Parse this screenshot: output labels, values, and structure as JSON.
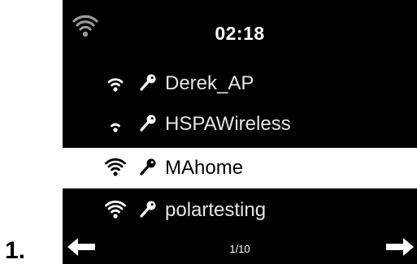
{
  "step_number": "1.",
  "status": {
    "wifi_icon": "wifi-signal-icon",
    "clock": "02:18"
  },
  "networks": [
    {
      "ssid": "Derek_AP",
      "secured": true,
      "signal_bars": 3,
      "selected": false
    },
    {
      "ssid": "HSPAWireless",
      "secured": true,
      "signal_bars": 2,
      "selected": false
    },
    {
      "ssid": "MAhome",
      "secured": true,
      "signal_bars": 4,
      "selected": true
    },
    {
      "ssid": "polartesting",
      "secured": true,
      "signal_bars": 4,
      "selected": false
    }
  ],
  "footer": {
    "page_indicator": "1/10",
    "prev_icon": "arrow-left-icon",
    "next_icon": "arrow-right-icon"
  },
  "colors": {
    "screen_bg": "#000000",
    "text": "#ffffff",
    "selected_bg": "#ffffff",
    "selected_text": "#000000"
  }
}
